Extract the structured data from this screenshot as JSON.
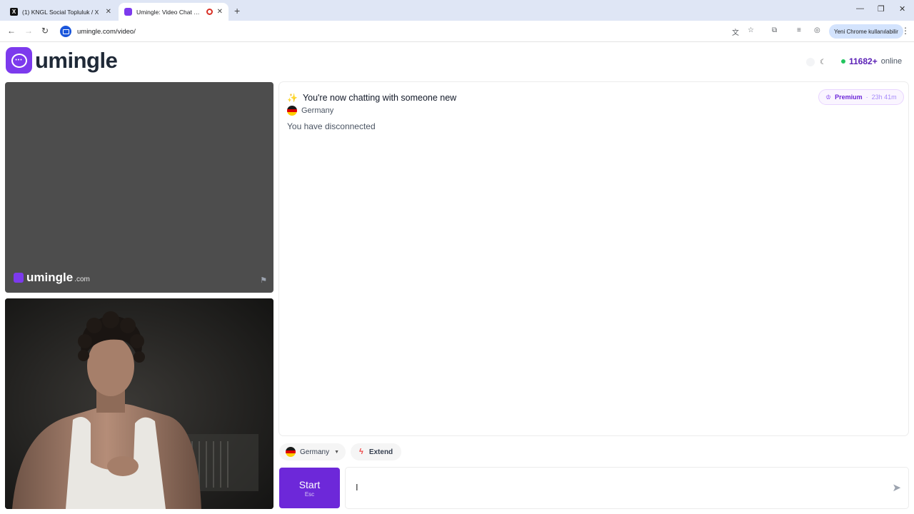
{
  "browser": {
    "tabs": [
      {
        "title": "(1) KNGL Social Topluluk / X",
        "favicon": "x-logo-icon"
      },
      {
        "title": "Umingle: Video Chat with S",
        "favicon": "umingle-icon",
        "recording": true
      }
    ],
    "url": "umingle.com/video/",
    "profile_label": "Yeni Chrome kullanılabilir"
  },
  "header": {
    "logo_text": "umingle",
    "online_count": "11682+",
    "online_label": "online"
  },
  "video": {
    "watermark_brand": "umingle",
    "watermark_tld": ".com"
  },
  "chat": {
    "title": "You're now chatting with someone new",
    "country": "Germany",
    "status": "You have disconnected",
    "premium_label": "Premium",
    "premium_separator": "·",
    "premium_time": "23h 41m"
  },
  "controls": {
    "country_filter": "Germany",
    "extend_label": "Extend",
    "start_label": "Start",
    "start_hint": "Esc",
    "message_placeholder": ""
  },
  "colors": {
    "brand": "#7c3aed",
    "start_button": "#6d28d9",
    "online_dot": "#22c55e"
  }
}
